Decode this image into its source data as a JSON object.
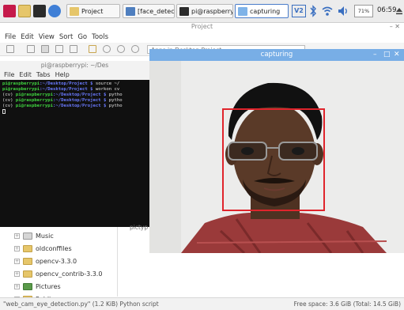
{
  "taskbar": {
    "tasks": [
      {
        "label": "Project"
      },
      {
        "label": "[face_detecti..."
      },
      {
        "label": "pi@raspberry..."
      },
      {
        "label": "capturing"
      }
    ],
    "tray": {
      "cpu_label": "71%",
      "clock": "06:59"
    }
  },
  "file_manager": {
    "title": "Project",
    "menu": [
      "File",
      "Edit",
      "View",
      "Sort",
      "Go",
      "Tools"
    ],
    "path_placeholder": "Apps in Desktop Project",
    "tree": [
      {
        "label": "Music",
        "icon": "music-folder-icon"
      },
      {
        "label": "oldconffiles",
        "icon": "folder-icon"
      },
      {
        "label": "opencv-3.3.0",
        "icon": "folder-icon"
      },
      {
        "label": "opencv_contrib-3.3.0",
        "icon": "folder-icon"
      },
      {
        "label": "Pictures",
        "icon": "pictures-folder-icon"
      },
      {
        "label": "Public",
        "icon": "folder-icon"
      }
    ],
    "partial_file_label": "pictyp",
    "status_left": "\"web_cam_eye_detection.py\" (1.2 KiB) Python script",
    "status_right": "Free space: 3.6 GiB (Total: 14.5 GiB)"
  },
  "terminal": {
    "title": "pi@raspberrypi: ~/Des",
    "menu": [
      "File",
      "Edit",
      "Tabs",
      "Help"
    ],
    "lines": [
      {
        "prefix": "",
        "prompt": "pi@raspberrypi",
        "dir": ":~/Desktop/Project $",
        "cmd": " source ~/"
      },
      {
        "prefix": "",
        "prompt": "pi@raspberrypi",
        "dir": ":~/Desktop/Project $",
        "cmd": " workon cv"
      },
      {
        "prefix": "(cv) ",
        "prompt": "pi@raspberrypi",
        "dir": ":~/Desktop/Project $",
        "cmd": " pytho"
      },
      {
        "prefix": "(cv) ",
        "prompt": "pi@raspberrypi",
        "dir": ":~/Desktop/Project $",
        "cmd": " pytho"
      },
      {
        "prefix": "(cv) ",
        "prompt": "pi@raspberrypi",
        "dir": ":~/Desktop/Project $",
        "cmd": " pytho"
      }
    ]
  },
  "capture_window": {
    "title": "capturing"
  }
}
